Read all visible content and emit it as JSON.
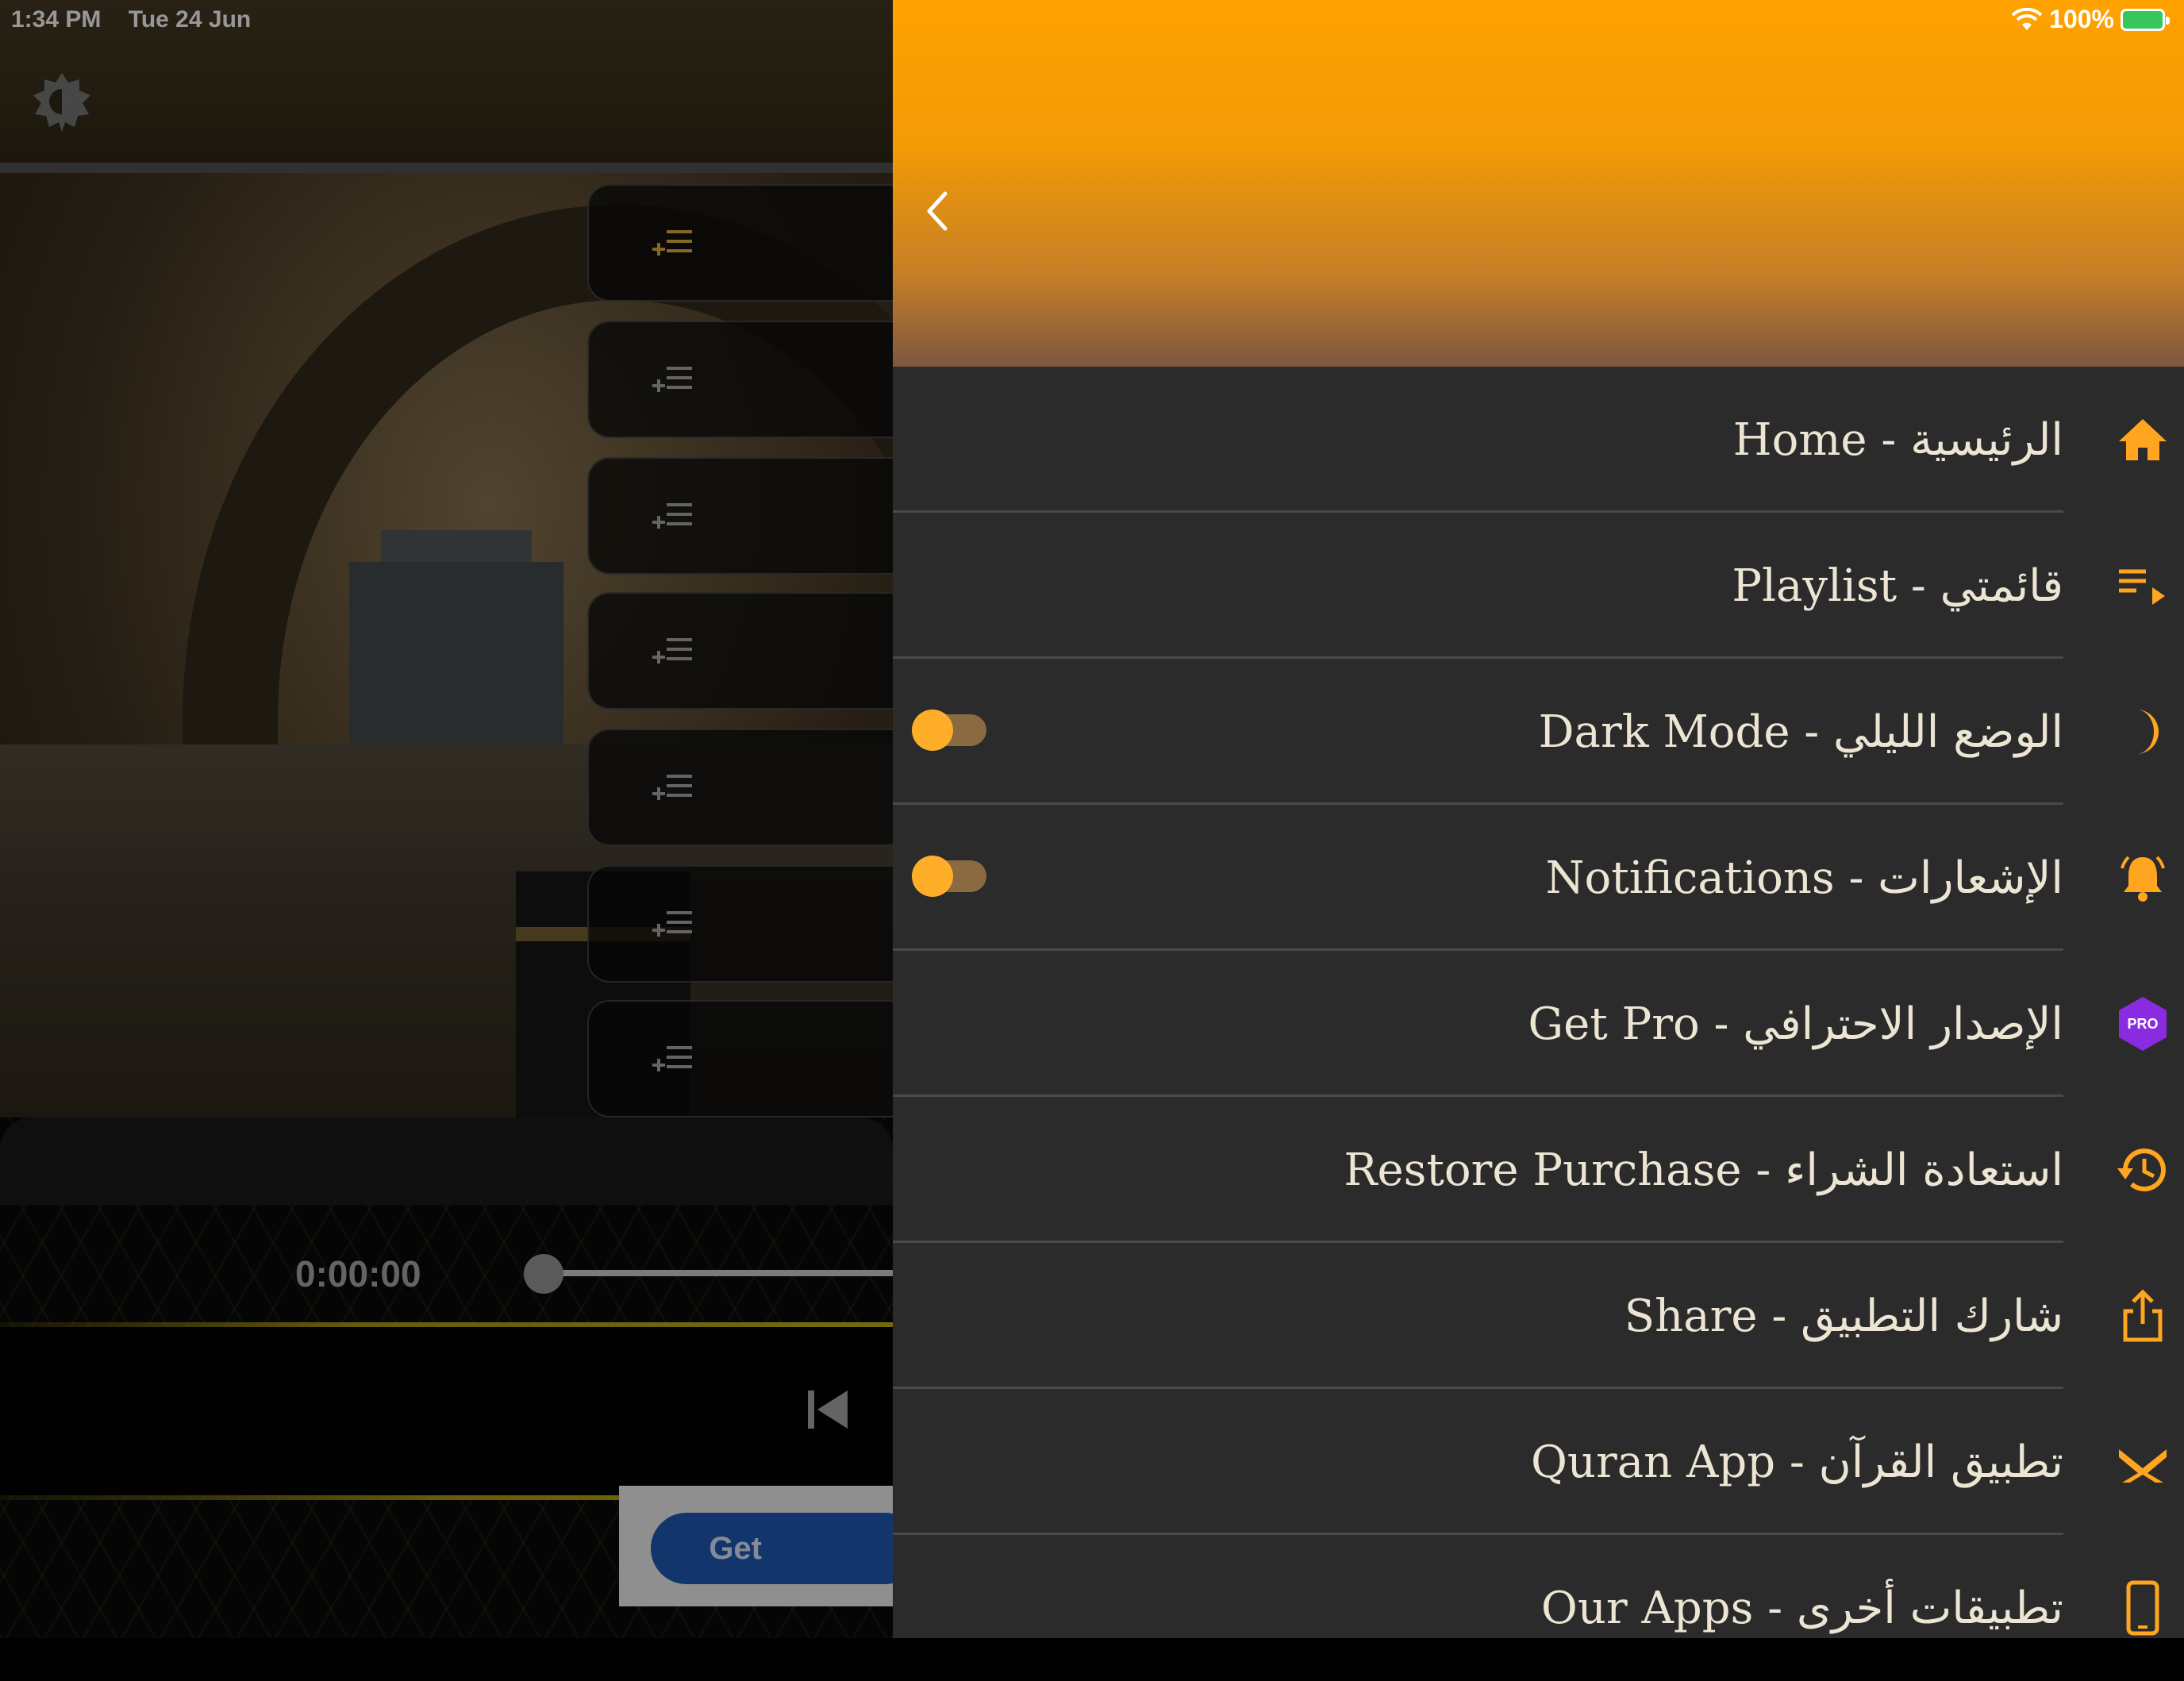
{
  "status_bar": {
    "time": "1:34 PM",
    "date": "Tue 24 Jun",
    "battery_text": "100%"
  },
  "player": {
    "current_time": "0:00:00",
    "ad_button_label": "Get"
  },
  "playlist_rows": [
    {
      "icon": "playlist-add-icon"
    },
    {
      "icon": "playlist-add-icon"
    },
    {
      "icon": "playlist-add-icon"
    },
    {
      "icon": "playlist-add-icon"
    },
    {
      "icon": "playlist-add-icon"
    },
    {
      "icon": "playlist-add-icon"
    },
    {
      "icon": "playlist-add-icon"
    }
  ],
  "drawer": {
    "menu": [
      {
        "label": "Home - الرئيسية",
        "icon": "home-icon"
      },
      {
        "label": "Playlist - قائمتي",
        "icon": "playlist-icon"
      },
      {
        "label": "Dark Mode - الوضع الليلي",
        "icon": "moon-icon",
        "toggle": "off"
      },
      {
        "label": "Notifications - الإشعارات",
        "icon": "bell-icon",
        "toggle": "off"
      },
      {
        "label": "Get Pro - الإصدار الاحترافي",
        "icon": "pro-badge-icon",
        "badge_text": "PRO"
      },
      {
        "label": "Restore Purchase - استعادة الشراء",
        "icon": "restore-icon"
      },
      {
        "label": "Share - شارك التطبيق",
        "icon": "share-icon"
      },
      {
        "label": "Quran App - تطبيق القرآن",
        "icon": "quran-icon"
      },
      {
        "label": "Our Apps - تطبيقات أخرى",
        "icon": "phone-icon"
      }
    ]
  },
  "colors": {
    "accent": "#ffa51f",
    "drawer_bg": "#2b2b2b",
    "pro_badge": "#8a2be2"
  }
}
